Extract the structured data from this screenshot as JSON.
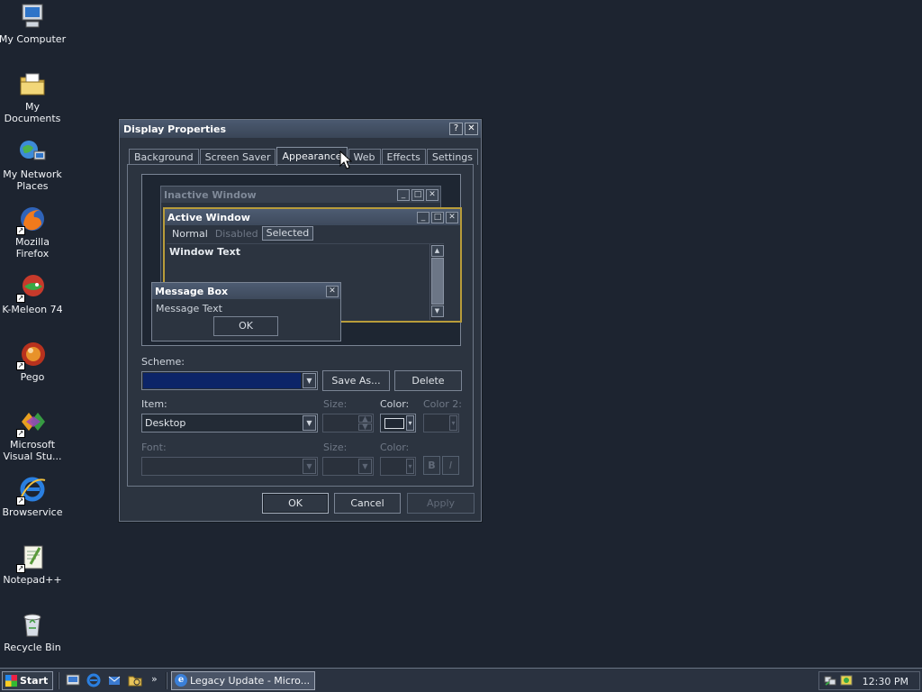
{
  "desktop": {
    "icons": [
      {
        "label": "My Computer",
        "icon": "computer-icon"
      },
      {
        "label": "My Documents",
        "icon": "folder-documents-icon"
      },
      {
        "label": "My Network Places",
        "icon": "network-icon"
      },
      {
        "label": "Mozilla Firefox",
        "icon": "firefox-icon"
      },
      {
        "label": "K-Meleon 74",
        "icon": "chameleon-icon"
      },
      {
        "label": "Pego",
        "icon": "pego-icon"
      },
      {
        "label": "Microsoft Visual Stu...",
        "icon": "visual-studio-icon"
      },
      {
        "label": "Browservice",
        "icon": "ie-icon"
      },
      {
        "label": "Notepad++",
        "icon": "notepad-icon"
      },
      {
        "label": "Recycle Bin",
        "icon": "recycle-bin-icon"
      }
    ]
  },
  "dialog": {
    "title": "Display Properties",
    "help_btn": "?",
    "close_btn": "✕",
    "tabs": [
      "Background",
      "Screen Saver",
      "Appearance",
      "Web",
      "Effects",
      "Settings"
    ],
    "active_tab": "Appearance",
    "preview": {
      "inactive_title": "Inactive Window",
      "active_title": "Active Window",
      "menu_normal": "Normal",
      "menu_disabled": "Disabled",
      "menu_selected": "Selected",
      "window_text": "Window Text",
      "msg_title": "Message Box",
      "msg_text": "Message Text",
      "msg_ok": "OK"
    },
    "scheme_label": "Scheme:",
    "scheme_value": "",
    "save_as": "Save As...",
    "delete": "Delete",
    "item_label": "Item:",
    "item_value": "Desktop",
    "size_label": "Size:",
    "color_label": "Color:",
    "color2_label": "Color 2:",
    "font_label": "Font:",
    "font_size_label": "Size:",
    "font_color_label": "Color:",
    "bold": "B",
    "italic": "I",
    "ok": "OK",
    "cancel": "Cancel",
    "apply": "Apply"
  },
  "taskbar": {
    "start": "Start",
    "task_label": "Legacy Update - Micro...",
    "clock": "12:30 PM",
    "more": "»"
  }
}
